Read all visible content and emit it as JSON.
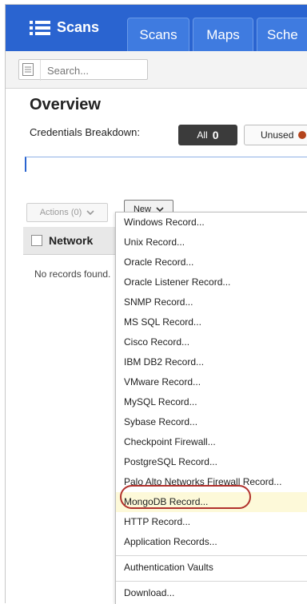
{
  "app": {
    "brand": "Scans",
    "tabs": [
      "Scans",
      "Maps",
      "Sche"
    ]
  },
  "search": {
    "placeholder": "Search..."
  },
  "overview": {
    "title": "Overview",
    "breakdown_label": "Credentials Breakdown:",
    "all_label": "All",
    "all_count": "0",
    "unused_label": "Unused"
  },
  "toolbar": {
    "actions_label": "Actions (0)",
    "new_label": "New"
  },
  "grid": {
    "column": "Network",
    "empty": "No records found."
  },
  "menu": {
    "items": [
      "Windows Record...",
      "Unix Record...",
      "Oracle Record...",
      "Oracle Listener Record...",
      "SNMP Record...",
      "MS SQL Record...",
      "Cisco Record...",
      "IBM DB2 Record...",
      "VMware Record...",
      "MySQL Record...",
      "Sybase Record...",
      "Checkpoint Firewall...",
      "PostgreSQL Record...",
      "Palo Alto Networks Firewall Record...",
      "MongoDB Record...",
      "HTTP Record...",
      "Application Records..."
    ],
    "vaults": "Authentication Vaults",
    "download": "Download..."
  },
  "colors": {
    "nav_blue": "#2a64d0",
    "highlight": "#fdf9d9",
    "annotation_oval": "#b1312c"
  }
}
